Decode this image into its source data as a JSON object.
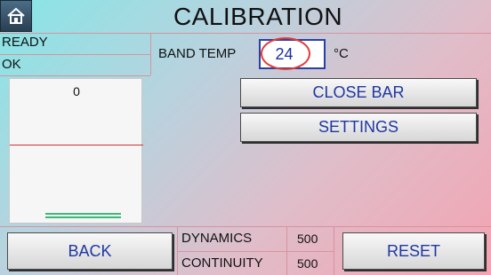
{
  "header": {
    "title": "CALIBRATION",
    "home_icon": "home-icon"
  },
  "status": {
    "line1": "READY",
    "line2": "OK"
  },
  "band_temp": {
    "label": "BAND TEMP",
    "value": "24",
    "unit": "°C"
  },
  "gauge": {
    "value": "0"
  },
  "buttons": {
    "close_bar": "CLOSE BAR",
    "settings": "SETTINGS",
    "back": "BACK",
    "reset": "RESET"
  },
  "params": {
    "dynamics_label": "DYNAMICS",
    "dynamics_value": "500",
    "continuity_label": "CONTINUITY",
    "continuity_value": "500"
  },
  "colors": {
    "button_text": "#1f37a3",
    "highlight_ring": "#e33a38",
    "grid_lines": "#d6939e"
  }
}
